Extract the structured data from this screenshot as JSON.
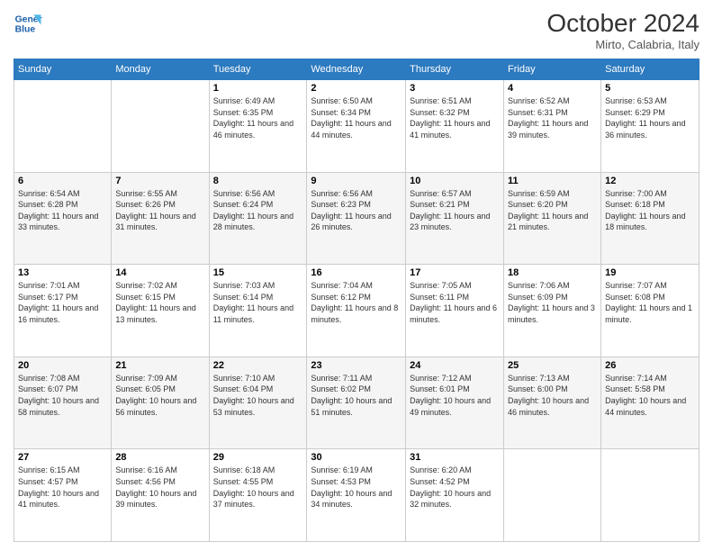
{
  "header": {
    "logo_line1": "General",
    "logo_line2": "Blue",
    "month": "October 2024",
    "location": "Mirto, Calabria, Italy"
  },
  "weekdays": [
    "Sunday",
    "Monday",
    "Tuesday",
    "Wednesday",
    "Thursday",
    "Friday",
    "Saturday"
  ],
  "weeks": [
    [
      null,
      null,
      {
        "day": 1,
        "sunrise": "6:49 AM",
        "sunset": "6:35 PM",
        "daylight": "11 hours and 46 minutes."
      },
      {
        "day": 2,
        "sunrise": "6:50 AM",
        "sunset": "6:34 PM",
        "daylight": "11 hours and 44 minutes."
      },
      {
        "day": 3,
        "sunrise": "6:51 AM",
        "sunset": "6:32 PM",
        "daylight": "11 hours and 41 minutes."
      },
      {
        "day": 4,
        "sunrise": "6:52 AM",
        "sunset": "6:31 PM",
        "daylight": "11 hours and 39 minutes."
      },
      {
        "day": 5,
        "sunrise": "6:53 AM",
        "sunset": "6:29 PM",
        "daylight": "11 hours and 36 minutes."
      }
    ],
    [
      {
        "day": 6,
        "sunrise": "6:54 AM",
        "sunset": "6:28 PM",
        "daylight": "11 hours and 33 minutes."
      },
      {
        "day": 7,
        "sunrise": "6:55 AM",
        "sunset": "6:26 PM",
        "daylight": "11 hours and 31 minutes."
      },
      {
        "day": 8,
        "sunrise": "6:56 AM",
        "sunset": "6:24 PM",
        "daylight": "11 hours and 28 minutes."
      },
      {
        "day": 9,
        "sunrise": "6:56 AM",
        "sunset": "6:23 PM",
        "daylight": "11 hours and 26 minutes."
      },
      {
        "day": 10,
        "sunrise": "6:57 AM",
        "sunset": "6:21 PM",
        "daylight": "11 hours and 23 minutes."
      },
      {
        "day": 11,
        "sunrise": "6:59 AM",
        "sunset": "6:20 PM",
        "daylight": "11 hours and 21 minutes."
      },
      {
        "day": 12,
        "sunrise": "7:00 AM",
        "sunset": "6:18 PM",
        "daylight": "11 hours and 18 minutes."
      }
    ],
    [
      {
        "day": 13,
        "sunrise": "7:01 AM",
        "sunset": "6:17 PM",
        "daylight": "11 hours and 16 minutes."
      },
      {
        "day": 14,
        "sunrise": "7:02 AM",
        "sunset": "6:15 PM",
        "daylight": "11 hours and 13 minutes."
      },
      {
        "day": 15,
        "sunrise": "7:03 AM",
        "sunset": "6:14 PM",
        "daylight": "11 hours and 11 minutes."
      },
      {
        "day": 16,
        "sunrise": "7:04 AM",
        "sunset": "6:12 PM",
        "daylight": "11 hours and 8 minutes."
      },
      {
        "day": 17,
        "sunrise": "7:05 AM",
        "sunset": "6:11 PM",
        "daylight": "11 hours and 6 minutes."
      },
      {
        "day": 18,
        "sunrise": "7:06 AM",
        "sunset": "6:09 PM",
        "daylight": "11 hours and 3 minutes."
      },
      {
        "day": 19,
        "sunrise": "7:07 AM",
        "sunset": "6:08 PM",
        "daylight": "11 hours and 1 minute."
      }
    ],
    [
      {
        "day": 20,
        "sunrise": "7:08 AM",
        "sunset": "6:07 PM",
        "daylight": "10 hours and 58 minutes."
      },
      {
        "day": 21,
        "sunrise": "7:09 AM",
        "sunset": "6:05 PM",
        "daylight": "10 hours and 56 minutes."
      },
      {
        "day": 22,
        "sunrise": "7:10 AM",
        "sunset": "6:04 PM",
        "daylight": "10 hours and 53 minutes."
      },
      {
        "day": 23,
        "sunrise": "7:11 AM",
        "sunset": "6:02 PM",
        "daylight": "10 hours and 51 minutes."
      },
      {
        "day": 24,
        "sunrise": "7:12 AM",
        "sunset": "6:01 PM",
        "daylight": "10 hours and 49 minutes."
      },
      {
        "day": 25,
        "sunrise": "7:13 AM",
        "sunset": "6:00 PM",
        "daylight": "10 hours and 46 minutes."
      },
      {
        "day": 26,
        "sunrise": "7:14 AM",
        "sunset": "5:58 PM",
        "daylight": "10 hours and 44 minutes."
      }
    ],
    [
      {
        "day": 27,
        "sunrise": "6:15 AM",
        "sunset": "4:57 PM",
        "daylight": "10 hours and 41 minutes."
      },
      {
        "day": 28,
        "sunrise": "6:16 AM",
        "sunset": "4:56 PM",
        "daylight": "10 hours and 39 minutes."
      },
      {
        "day": 29,
        "sunrise": "6:18 AM",
        "sunset": "4:55 PM",
        "daylight": "10 hours and 37 minutes."
      },
      {
        "day": 30,
        "sunrise": "6:19 AM",
        "sunset": "4:53 PM",
        "daylight": "10 hours and 34 minutes."
      },
      {
        "day": 31,
        "sunrise": "6:20 AM",
        "sunset": "4:52 PM",
        "daylight": "10 hours and 32 minutes."
      },
      null,
      null
    ]
  ]
}
